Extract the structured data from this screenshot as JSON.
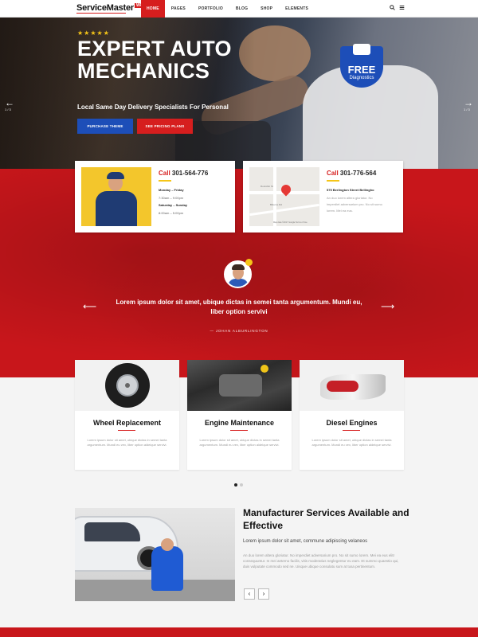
{
  "nav": {
    "logo": "ServiceMaster",
    "logo_badge": "WP",
    "menu": [
      "HOME",
      "PAGES",
      "PORTFOLIO",
      "BLOG",
      "SHOP",
      "ELEMENTS"
    ],
    "icons": [
      "search-icon",
      "menu-icon"
    ]
  },
  "hero": {
    "rating_stars": "★★★★★",
    "title": "EXPERT AUTO MECHANICS",
    "subtitle": "Local Same Day Delivery Specialists For Personal",
    "btn_primary": "PURCHASE THEME",
    "btn_secondary": "SEE PRICING PLANS",
    "badge_big": "FREE",
    "badge_small": "Diagnostics",
    "slide_counter_left": "1 / 3",
    "slide_counter_right": "1 / 3"
  },
  "contact_cards": [
    {
      "call_label": "Call",
      "phone": "301-564-776",
      "line1": "Monday – Friday",
      "line2": "7:30am – 9:00pm",
      "line3": "Saturday – Sunday",
      "line4": "8:00am – 5:00pm"
    },
    {
      "call_label": "Call",
      "phone": "301-776-564",
      "line1": "575 Berlington Street Bellingho",
      "line2": "An duo lorem altera gloriatur. No",
      "line3": "imperdiet adversarium pro. No sit sumo",
      "line4": "lorem. Mei ea eus."
    }
  ],
  "map": {
    "labels": [
      "Dunrobin St",
      "Bitterne Rd",
      "Map data ©2017 Google   Terms of Use"
    ]
  },
  "testimonial": {
    "quote": "Lorem ipsum dolor sit amet, ubique dictas in semei tanta argumentum. Mundi eu, liber option servivi",
    "author": "— JOHAN ALBURLINGTON"
  },
  "services": [
    {
      "title": "Wheel Replacement",
      "desc": "Lorem ipsum dolor sit amet, ubique dictas in semei tanta argumentum. Mundi eu vex, liber option aldeique servivi."
    },
    {
      "title": "Engine Maintenance",
      "desc": "Lorem ipsum dolor sit amet, ubique dictas in semei tanta argumentum. Mundi eu vex, liber option aldeique servivi."
    },
    {
      "title": "Diesel Engines",
      "desc": "Lorem ipsum dolor sit amet, ubique dictas in semei tanta argumentum. Mundi eu vex, liber option aldeique servivi."
    }
  ],
  "manufacturer": {
    "title": "Manufacturer Services Available and Effective",
    "subtitle": "Lorem ipsum dolor sit amet, commune adipiscing velaneos",
    "desc": "An duo lorem altera gloriatur. No imperdiet adversarium pro. No sit sumo lorem. Mei ea eus elitr consequuntur. In mei aeterno facilis, vitis moderatius neglegentur eu eam. Et summo quaestio qui, duis vulputate commodo sed ne. Uisque ubique consulatu sum at tusa pertinentum.",
    "prev": "‹",
    "next": "›"
  },
  "colors": {
    "accent_red": "#d61e1e",
    "accent_blue": "#1d4eb8",
    "star_yellow": "#f5c518"
  }
}
